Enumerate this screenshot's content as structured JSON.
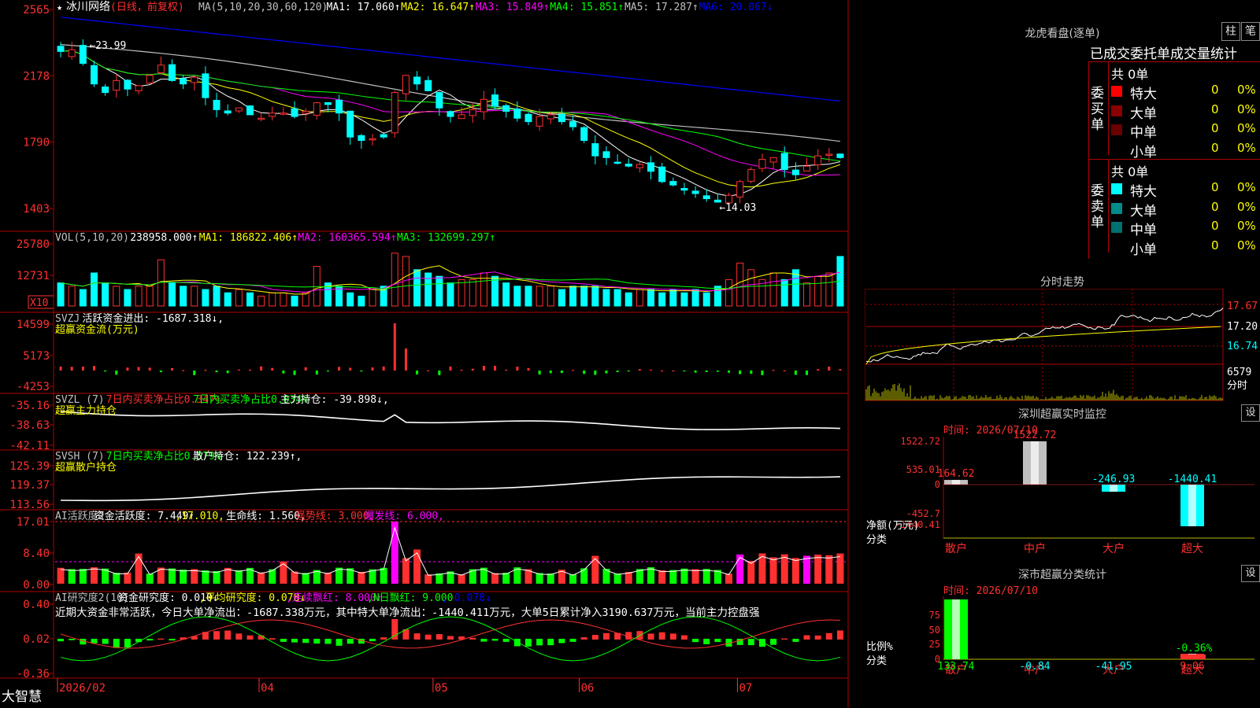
{
  "app_name": "大智慧",
  "stock": {
    "name": "冰川网络",
    "mode": "(日线，前复权)"
  },
  "x_axis": {
    "labels": [
      "2026/02",
      "04",
      "05",
      "06",
      "07"
    ],
    "label_pos": [
      0.0,
      0.255,
      0.475,
      0.66,
      0.86
    ]
  },
  "price_panel": {
    "legend": [
      {
        "text": "MA(5,10,20,30,60,120)",
        "color": "#c0c0c0"
      },
      {
        "text": "MA1: 17.060↑",
        "color": "#ffffff"
      },
      {
        "text": "MA2: 16.647↑",
        "color": "#ffff00"
      },
      {
        "text": "MA3: 15.849↑",
        "color": "#ff00ff"
      },
      {
        "text": "MA4: 15.851↑",
        "color": "#00ff00"
      },
      {
        "text": "MA5: 17.287↑",
        "color": "#c0c0c0"
      },
      {
        "text": "MA6: 20.067↓",
        "color": "#0000ff"
      }
    ],
    "y_ticks": [
      "2565",
      "2178",
      "1790",
      "1403"
    ],
    "high_note": "←23.99",
    "low_note": "←14.03"
  },
  "vol_panel": {
    "legend": [
      {
        "text": "VOL(5,10,20)",
        "color": "#c0c0c0"
      },
      {
        "text": "238958.000↑",
        "color": "#ffffff"
      },
      {
        "text": "MA1: 186822.406↑",
        "color": "#ffff00"
      },
      {
        "text": "MA2: 160365.594↑",
        "color": "#ff00ff"
      },
      {
        "text": "MA3: 132699.297↑",
        "color": "#00ff00"
      }
    ],
    "y_ticks": [
      "25780",
      "12731"
    ],
    "unit": "X10"
  },
  "svzj_panel": {
    "legend": [
      {
        "text": "SVZJ",
        "color": "#c0c0c0"
      },
      {
        "text": "活跃资金进出: -1687.318↓,",
        "color": "#ffffff"
      }
    ],
    "subtitle": "超赢资金流(万元)",
    "y_ticks": [
      "14599",
      "5173",
      "-4253"
    ]
  },
  "svzl_panel": {
    "legend": [
      {
        "text": "SVZL (7)",
        "color": "#c0c0c0"
      },
      {
        "text": "7日内买卖净占比0.347%",
        "color": "#ff3030"
      },
      {
        "text": "7日内买卖净占比0.034%",
        "color": "#00ff00"
      },
      {
        "text": "主力持仓: -39.898↓,",
        "color": "#ffffff"
      }
    ],
    "subtitle": "超赢主力持仓",
    "y_ticks": [
      "-35.16",
      "-38.63",
      "-42.11"
    ]
  },
  "svsh_panel": {
    "legend": [
      {
        "text": "SVSH (7)",
        "color": "#c0c0c0"
      },
      {
        "text": "7日内买卖净占比0.579%",
        "color": "#00ff00"
      },
      {
        "text": "散户持仓: 122.239↑,",
        "color": "#ffffff"
      }
    ],
    "subtitle": "超赢散户持仓",
    "y_ticks": [
      "125.39",
      "119.37",
      "113.56"
    ]
  },
  "ai_active_panel": {
    "legend": [
      {
        "text": "AI活跃度2",
        "color": "#c0c0c0"
      },
      {
        "text": "资金活跃度: 7.449↑",
        "color": "#ffffff"
      },
      {
        "text": ",17.010,",
        "color": "#ffff00"
      },
      {
        "text": "生命线: 1.560,",
        "color": "#ffffff"
      },
      {
        "text": "强势线: 3.000,",
        "color": "#ff3030"
      },
      {
        "text": "爆发线: 6.000,",
        "color": "#ff00ff"
      }
    ],
    "y_ticks": [
      "17.01",
      "8.40",
      "0.00"
    ]
  },
  "ai_research_panel": {
    "legend": [
      {
        "text": "AI研究度2(10)",
        "color": "#c0c0c0"
      },
      {
        "text": "资金研究度: 0.010↓",
        "color": "#ffffff"
      },
      {
        "text": ",平均研究度: 0.078↓",
        "color": "#ffff00"
      },
      {
        "text": ",连续飘红: 8.000↑",
        "color": "#ff00ff"
      },
      {
        "text": ",N日飘红: 9.000",
        "color": "#00ff00"
      },
      {
        "text": ", 0.078↓",
        "color": "#0000ff"
      }
    ],
    "message": "近期大资金非常活跃，今日大单净流出：-1687.338万元，其中特大单净流出：-1440.411万元，大单5日累计净入3190.637万元，当前主力控盘强",
    "y_ticks": [
      "0.40",
      "0.02",
      "-0.36"
    ]
  },
  "longhu": {
    "title": "龙虎看盘(逐单)",
    "tab_bar": "柱",
    "tab_pen": "笔",
    "subtitle": "已成交委托单成交量统计",
    "buy": {
      "side_label": "委买单",
      "total": "共 0单",
      "rows": [
        {
          "name": "特大",
          "count": "0",
          "pct": "0%",
          "color": "#ff0000"
        },
        {
          "name": "大单",
          "count": "0",
          "pct": "0%",
          "color": "#8b0000"
        },
        {
          "name": "中单",
          "count": "0",
          "pct": "0%",
          "color": "#6b0000"
        },
        {
          "name": "小单",
          "count": "0",
          "pct": "0%",
          "color": ""
        }
      ]
    },
    "sell": {
      "side_label": "委卖单",
      "total": "共 0单",
      "rows": [
        {
          "name": "特大",
          "count": "0",
          "pct": "0%",
          "color": "#00ffff"
        },
        {
          "name": "大单",
          "count": "0",
          "pct": "0%",
          "color": "#008b8b"
        },
        {
          "name": "中单",
          "count": "0",
          "pct": "0%",
          "color": "#007070"
        },
        {
          "name": "小单",
          "count": "0",
          "pct": "0%",
          "color": ""
        }
      ]
    }
  },
  "intraday": {
    "title": "分时走势",
    "y_ticks": [
      "17.67",
      "17.20",
      "16.74"
    ],
    "vol_tick": "6579",
    "vol_label": "分时"
  },
  "sz_monitor": {
    "title": "深圳超赢实时监控",
    "settings": "设",
    "time": "时间: 2026/07/10",
    "y_ticks": [
      "1522.72",
      "535.01",
      "0",
      "-452.7",
      "-1440.41"
    ],
    "y_label": "净额(万元)",
    "x_label": "分类",
    "categories": [
      "散户",
      "中户",
      "大户",
      "超大"
    ],
    "value_labels": [
      "164.62",
      "1522.72",
      "-246.93",
      "-1440.41"
    ],
    "ylim": [
      -1440.41,
      1522.72
    ]
  },
  "sz_stats": {
    "title": "深市超赢分类统计",
    "settings": "设",
    "time": "时间: 2026/07/10",
    "y_ticks": [
      "75",
      "50",
      "25",
      "0"
    ],
    "y_label": "比例%",
    "x_label": "分类",
    "categories": [
      "散户",
      "中户",
      "大户",
      "超大"
    ],
    "value_labels": [
      "133.74",
      "-0.84",
      "-41.95",
      "9.06"
    ],
    "bar_note": "-0.36%"
  },
  "chart_data": [
    {
      "type": "candlestick",
      "title": "冰川网络 (日线，前复权)",
      "ylim": [
        14.03,
        25.65
      ],
      "high": 23.99,
      "low": 14.03,
      "close_path": [
        23.2,
        23.3,
        22.5,
        21.3,
        20.8,
        21.5,
        21.0,
        21.2,
        21.8,
        22.4,
        21.5,
        21.3,
        21.7,
        20.5,
        19.8,
        19.6,
        19.9,
        19.5,
        19.3,
        19.6,
        19.6,
        19.4,
        19.7,
        20.2,
        20.1,
        19.6,
        18.2,
        18.0,
        18.1,
        18.2,
        20.8,
        21.8,
        21.3,
        20.9,
        19.9,
        19.4,
        19.5,
        19.8,
        20.4,
        20.0,
        19.7,
        19.3,
        19.1,
        19.4,
        19.5,
        19.1,
        18.8,
        18.0,
        17.1,
        17.0,
        16.7,
        16.5,
        16.6,
        16.2,
        15.6,
        15.4,
        15.1,
        14.9,
        14.6,
        14.4,
        14.8,
        15.6,
        16.3,
        16.9,
        17.0,
        16.3,
        16.0,
        16.5,
        17.1,
        17.2,
        17.0
      ]
    },
    {
      "type": "bar",
      "title": "VOL(5,10,20)",
      "values": [
        238958.0
      ],
      "ma": [
        186822.406,
        160365.594,
        132699.297
      ],
      "ylim": [
        0,
        257800
      ]
    },
    {
      "type": "bar",
      "title": "SVZJ 活跃资金进出",
      "values": [
        -1687.318
      ],
      "ylim": [
        -4253,
        14599
      ]
    },
    {
      "type": "line",
      "title": "SVZL 主力持仓",
      "values": [
        -39.898
      ],
      "ylim": [
        -42.11,
        -35.16
      ]
    },
    {
      "type": "line",
      "title": "SVSH 散户持仓",
      "values": [
        122.239
      ],
      "ylim": [
        113.56,
        125.39
      ]
    },
    {
      "type": "bar",
      "title": "AI活跃度2",
      "values": [
        7.449
      ],
      "ylim": [
        0,
        17.01
      ]
    },
    {
      "type": "bar",
      "title": "AI研究度2(10)",
      "values": [
        0.01
      ],
      "ylim": [
        -0.36,
        0.4
      ]
    },
    {
      "type": "bar",
      "title": "深圳超赢实时监控",
      "categories": [
        "散户",
        "中户",
        "大户",
        "超大"
      ],
      "values": [
        164.62,
        1522.72,
        -246.93,
        -1440.41
      ],
      "ylim": [
        -1440.41,
        1522.72
      ]
    },
    {
      "type": "bar",
      "title": "深市超赢分类统计",
      "categories": [
        "散户",
        "中户",
        "大户",
        "超大"
      ],
      "values": [
        133.74,
        -0.84,
        -41.95,
        9.06
      ],
      "ylim": [
        0,
        100
      ]
    }
  ]
}
